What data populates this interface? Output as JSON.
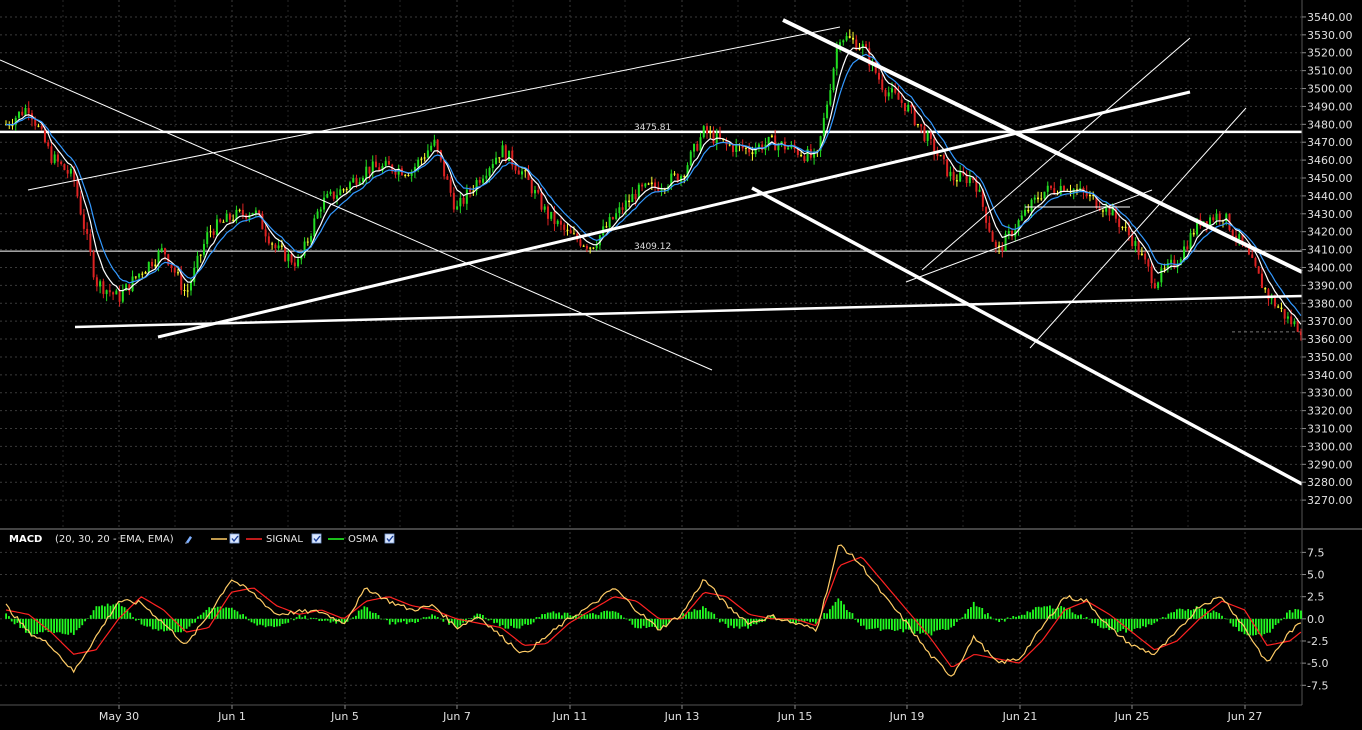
{
  "colors": {
    "background": "#000000",
    "grid": "#3a3a3a",
    "up_candle": "#22dd22",
    "down_candle": "#dd2222",
    "doji_candle": "#ffff33",
    "ema_fast": "#ffffff",
    "ema_slow": "#3399ff",
    "macd_line": "#ffcc66",
    "signal_line": "#ff2222",
    "osma_hist": "#22ff22",
    "trendline": "#ffffff"
  },
  "price_panel": {
    "hlines": [
      {
        "value": 3475.81,
        "label": "3475.81"
      },
      {
        "value": 3409.12,
        "label": "3409.12"
      }
    ],
    "y_axis": {
      "min": 3260,
      "max": 3545,
      "ticks": [
        "3540.00",
        "3530.00",
        "3520.00",
        "3510.00",
        "3500.00",
        "3490.00",
        "3480.00",
        "3470.00",
        "3460.00",
        "3450.00",
        "3440.00",
        "3430.00",
        "3420.00",
        "3410.00",
        "3400.00",
        "3390.00",
        "3380.00",
        "3370.00",
        "3360.00",
        "3350.00",
        "3340.00",
        "3330.00",
        "3320.00",
        "3310.00",
        "3300.00",
        "3290.00",
        "3280.00",
        "3270.00"
      ]
    }
  },
  "macd_panel": {
    "legend": {
      "title": "MACD",
      "params": "(20, 30, 20 - EMA, EMA)",
      "signal_label": "SIGNAL",
      "osma_label": "OSMA"
    },
    "y_axis": {
      "min": -9.5,
      "max": 9.8,
      "ticks": [
        "7.5",
        "5.0",
        "2.5",
        "0.0",
        "-2.5",
        "-5.0",
        "-7.5"
      ]
    }
  },
  "x_axis": {
    "labels": [
      "May 30",
      "Jun 1",
      "Jun 5",
      "Jun 7",
      "Jun 11",
      "Jun 13",
      "Jun 15",
      "Jun 19",
      "Jun 21",
      "Jun 25",
      "Jun 27"
    ]
  },
  "chart_data": [
    {
      "type": "line",
      "title": "",
      "xlabel": "",
      "ylabel": "",
      "x_labels": [
        "May 30",
        "Jun 1",
        "Jun 5",
        "Jun 7",
        "Jun 11",
        "Jun 13",
        "Jun 15",
        "Jun 19",
        "Jun 21",
        "Jun 25",
        "Jun 27"
      ],
      "ylim": [
        3260,
        3545
      ],
      "price_anchors": {
        "t": [
          0.0,
          0.4,
          0.8,
          1.2,
          1.6,
          2.0,
          2.4,
          2.8,
          3.2,
          3.6,
          4.0,
          4.4,
          4.8,
          5.2,
          5.6,
          6.0,
          6.4,
          6.8,
          7.2,
          7.6,
          8.0,
          8.4,
          8.8,
          9.2,
          9.6,
          10.0,
          10.4,
          10.8,
          11.2,
          11.6,
          12.0,
          12.4,
          12.8,
          13.2,
          13.6,
          14.0,
          14.4,
          14.8,
          15.2,
          15.6,
          16.0,
          16.4,
          16.8,
          17.2,
          17.6,
          18.0,
          18.4,
          18.8,
          19.2,
          19.6,
          20.0,
          20.4,
          20.8,
          21.2,
          21.6,
          22.0,
          22.4,
          22.8,
          23.0
        ],
        "price": [
          3480,
          3490,
          3462,
          3450,
          3392,
          3383,
          3398,
          3410,
          3385,
          3420,
          3428,
          3432,
          3410,
          3402,
          3436,
          3444,
          3455,
          3456,
          3454,
          3470,
          3432,
          3450,
          3466,
          3452,
          3430,
          3418,
          3412,
          3428,
          3442,
          3446,
          3452,
          3476,
          3468,
          3466,
          3470,
          3466,
          3460,
          3530,
          3524,
          3500,
          3490,
          3470,
          3450,
          3450,
          3408,
          3426,
          3442,
          3446,
          3440,
          3432,
          3416,
          3392,
          3404,
          3426,
          3430,
          3410,
          3385,
          3370,
          3366
        ]
      },
      "hlines": [
        3475.81,
        3409.12
      ]
    },
    {
      "type": "line",
      "title": "",
      "ylim": [
        -9.5,
        9.8
      ],
      "series": [
        {
          "name": "MACD",
          "values_anchors": [
            [
              0.0,
              1.5
            ],
            [
              0.4,
              -1.5
            ],
            [
              0.8,
              -3.0
            ],
            [
              1.2,
              -6.0
            ],
            [
              1.6,
              -2.0
            ],
            [
              2.0,
              2.0
            ],
            [
              2.4,
              1.8
            ],
            [
              2.8,
              -0.5
            ],
            [
              3.2,
              -3.0
            ],
            [
              3.6,
              0.5
            ],
            [
              4.0,
              4.5
            ],
            [
              4.4,
              2.8
            ],
            [
              4.8,
              0.5
            ],
            [
              5.2,
              0.8
            ],
            [
              5.6,
              0.8
            ],
            [
              6.0,
              -0.5
            ],
            [
              6.4,
              3.5
            ],
            [
              6.8,
              2.0
            ],
            [
              7.2,
              1.0
            ],
            [
              7.6,
              1.5
            ],
            [
              8.0,
              -1.0
            ],
            [
              8.4,
              0.3
            ],
            [
              8.8,
              -2.0
            ],
            [
              9.2,
              -4.0
            ],
            [
              9.6,
              -2.0
            ],
            [
              10.0,
              0.0
            ],
            [
              10.4,
              1.5
            ],
            [
              10.8,
              3.5
            ],
            [
              11.2,
              1.0
            ],
            [
              11.6,
              -1.2
            ],
            [
              12.0,
              0.5
            ],
            [
              12.4,
              4.5
            ],
            [
              12.8,
              1.5
            ],
            [
              13.2,
              -0.5
            ],
            [
              13.6,
              0.3
            ],
            [
              14.0,
              -0.5
            ],
            [
              14.4,
              -1.2
            ],
            [
              14.8,
              8.5
            ],
            [
              15.2,
              6.0
            ],
            [
              15.6,
              2.5
            ],
            [
              16.0,
              -0.5
            ],
            [
              16.4,
              -4.0
            ],
            [
              16.8,
              -6.5
            ],
            [
              17.2,
              -2.0
            ],
            [
              17.6,
              -5.0
            ],
            [
              18.0,
              -4.5
            ],
            [
              18.4,
              -1.0
            ],
            [
              18.8,
              2.5
            ],
            [
              19.2,
              2.0
            ],
            [
              19.6,
              -1.0
            ],
            [
              20.0,
              -3.0
            ],
            [
              20.4,
              -4.0
            ],
            [
              20.8,
              -1.5
            ],
            [
              21.2,
              1.5
            ],
            [
              21.6,
              2.5
            ],
            [
              22.0,
              -1.0
            ],
            [
              22.4,
              -5.0
            ],
            [
              22.8,
              -1.5
            ],
            [
              23.0,
              -0.5
            ]
          ]
        },
        {
          "name": "SIGNAL",
          "values_anchors": [
            [
              0.0,
              1.0
            ],
            [
              0.4,
              0.5
            ],
            [
              0.8,
              -1.5
            ],
            [
              1.2,
              -4.0
            ],
            [
              1.6,
              -3.5
            ],
            [
              2.0,
              0.0
            ],
            [
              2.4,
              2.5
            ],
            [
              2.8,
              1.0
            ],
            [
              3.2,
              -1.5
            ],
            [
              3.6,
              -1.0
            ],
            [
              4.0,
              3.0
            ],
            [
              4.4,
              3.5
            ],
            [
              4.8,
              1.5
            ],
            [
              5.2,
              0.5
            ],
            [
              5.6,
              1.0
            ],
            [
              6.0,
              0.0
            ],
            [
              6.4,
              2.0
            ],
            [
              6.8,
              2.5
            ],
            [
              7.2,
              1.5
            ],
            [
              7.6,
              1.0
            ],
            [
              8.0,
              0.0
            ],
            [
              8.4,
              -0.5
            ],
            [
              8.8,
              -1.0
            ],
            [
              9.2,
              -3.0
            ],
            [
              9.6,
              -2.8
            ],
            [
              10.0,
              -0.5
            ],
            [
              10.4,
              1.0
            ],
            [
              10.8,
              2.5
            ],
            [
              11.2,
              2.0
            ],
            [
              11.6,
              0.0
            ],
            [
              12.0,
              0.0
            ],
            [
              12.4,
              3.0
            ],
            [
              12.8,
              2.5
            ],
            [
              13.2,
              0.5
            ],
            [
              13.6,
              0.0
            ],
            [
              14.0,
              0.0
            ],
            [
              14.4,
              -0.8
            ],
            [
              14.8,
              6.0
            ],
            [
              15.2,
              7.0
            ],
            [
              15.6,
              4.0
            ],
            [
              16.0,
              1.0
            ],
            [
              16.4,
              -2.0
            ],
            [
              16.8,
              -5.5
            ],
            [
              17.2,
              -4.0
            ],
            [
              17.6,
              -4.5
            ],
            [
              18.0,
              -5.0
            ],
            [
              18.4,
              -2.5
            ],
            [
              18.8,
              1.0
            ],
            [
              19.2,
              2.0
            ],
            [
              19.6,
              0.5
            ],
            [
              20.0,
              -1.5
            ],
            [
              20.4,
              -3.5
            ],
            [
              20.8,
              -2.5
            ],
            [
              21.2,
              0.0
            ],
            [
              21.6,
              2.0
            ],
            [
              22.0,
              1.0
            ],
            [
              22.4,
              -3.0
            ],
            [
              22.8,
              -2.5
            ],
            [
              23.0,
              -1.5
            ]
          ]
        }
      ],
      "osma": "MACD minus SIGNAL, histogram"
    }
  ]
}
